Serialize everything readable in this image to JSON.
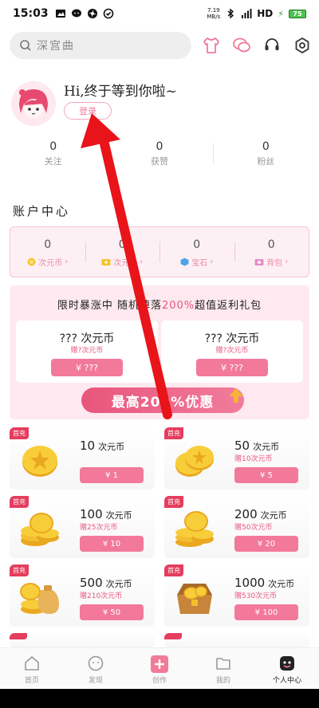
{
  "status_bar": {
    "time": "15:03",
    "net_speed_value": "7.19",
    "net_speed_unit": "MB/s",
    "signal": "HD",
    "battery": "75"
  },
  "search": {
    "placeholder": "深宫曲"
  },
  "header_icons": [
    "wardrobe-icon",
    "chat-icon",
    "headset-icon",
    "settings-icon"
  ],
  "profile": {
    "greeting": "Hi,终于等到你啦~",
    "login_label": "登录"
  },
  "stats": [
    {
      "value": "0",
      "label": "关注"
    },
    {
      "value": "0",
      "label": "获赞"
    },
    {
      "value": "0",
      "label": "粉丝"
    }
  ],
  "account_center": {
    "title": "账户中心",
    "items": [
      {
        "value": "0",
        "label": "次元币"
      },
      {
        "value": "0",
        "label": "次元券"
      },
      {
        "value": "0",
        "label": "宝石"
      },
      {
        "value": "0",
        "label": "背包"
      }
    ]
  },
  "promo": {
    "title_a": "限时暴涨中 随机掉落",
    "title_pct": "200%",
    "title_b": "超值返利礼包",
    "cards": [
      {
        "title": "??? 次元币",
        "sub": "赠?次元币",
        "price": "¥ ???"
      },
      {
        "title": "??? 次元币",
        "sub": "赠?次元币",
        "price": "¥ ???"
      }
    ],
    "banner": "最高200%优惠"
  },
  "packages": [
    {
      "tag": "首充",
      "amount": "10",
      "unit": "次元币",
      "bonus": "",
      "price": "¥ 1"
    },
    {
      "tag": "首充",
      "amount": "50",
      "unit": "次元币",
      "bonus": "赠10次元币",
      "price": "¥ 5"
    },
    {
      "tag": "首充",
      "amount": "100",
      "unit": "次元币",
      "bonus": "赠25次元币",
      "price": "¥ 10"
    },
    {
      "tag": "首充",
      "amount": "200",
      "unit": "次元币",
      "bonus": "赠50次元币",
      "price": "¥ 20"
    },
    {
      "tag": "首充",
      "amount": "500",
      "unit": "次元币",
      "bonus": "赠210次元币",
      "price": "¥ 50"
    },
    {
      "tag": "首充",
      "amount": "1000",
      "unit": "次元币",
      "bonus": "赠530次元币",
      "price": "¥ 100"
    }
  ],
  "bottom_nav": [
    {
      "label": "首页",
      "icon": "home-icon"
    },
    {
      "label": "发现",
      "icon": "discover-icon"
    },
    {
      "label": "创作",
      "icon": "create-icon"
    },
    {
      "label": "我的",
      "icon": "folder-icon"
    },
    {
      "label": "个人中心",
      "icon": "profile-icon"
    }
  ],
  "colors": {
    "accent": "#f2799a",
    "promo_bg": "#fde9ef",
    "annotation": "#e8141a"
  }
}
